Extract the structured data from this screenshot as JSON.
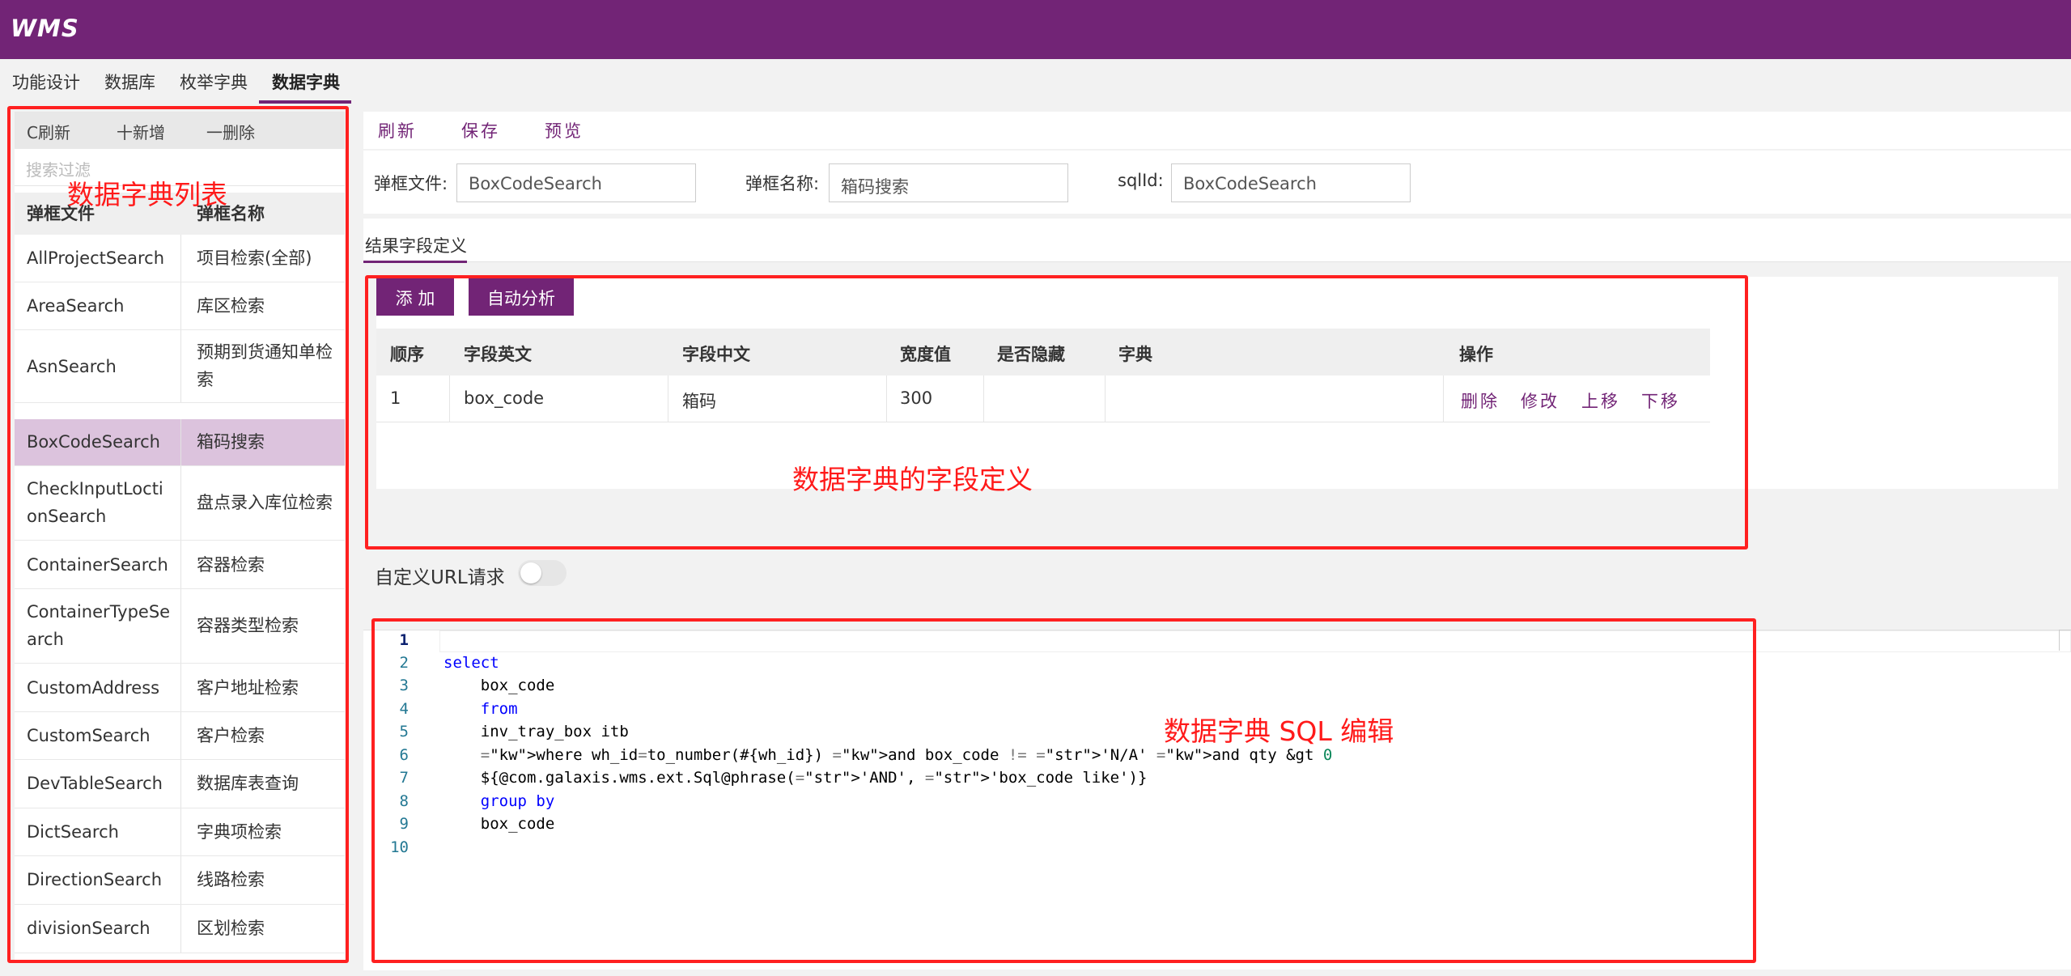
{
  "app": {
    "logo": "WMS",
    "brand_color": "#722476"
  },
  "tabs": [
    {
      "label": "功能设计",
      "active": false
    },
    {
      "label": "数据库",
      "active": false
    },
    {
      "label": "枚举字典",
      "active": false
    },
    {
      "label": "数据字典",
      "active": true
    }
  ],
  "left": {
    "toolbar": {
      "refresh": "C刷新",
      "add": "十新增",
      "delete": "一删除"
    },
    "search_placeholder": "搜索过滤",
    "columns": [
      "弹框文件",
      "弹框名称"
    ],
    "rows": [
      {
        "file": "AllProjectSearch",
        "name": "项目检索(全部)"
      },
      {
        "file": "AreaSearch",
        "name": "库区检索"
      },
      {
        "file": "AsnSearch",
        "name": "预期到货通知单检索"
      },
      {
        "file": "BoxCodeSearch",
        "name": "箱码搜索",
        "selected": true
      },
      {
        "file": "CheckInputLoctionSearch",
        "name": "盘点录入库位检索"
      },
      {
        "file": "ContainerSearch",
        "name": "容器检索"
      },
      {
        "file": "ContainerTypeSearch",
        "name": "容器类型检索"
      },
      {
        "file": "CustomAddress",
        "name": "客户地址检索"
      },
      {
        "file": "CustomSearch",
        "name": "客户检索"
      },
      {
        "file": "DevTableSearch",
        "name": "数据库表查询"
      },
      {
        "file": "DictSearch",
        "name": "字典项检索"
      },
      {
        "file": "DirectionSearch",
        "name": "线路检索"
      },
      {
        "file": "divisionSearch",
        "name": "区划检索"
      }
    ]
  },
  "right": {
    "toolbar": {
      "refresh": "刷新",
      "save": "保存",
      "preview": "预览"
    },
    "form": {
      "file_label": "弹框文件:",
      "file_value": "BoxCodeSearch",
      "name_label": "弹框名称:",
      "name_value": "箱码搜索",
      "sql_label": "sqlId:",
      "sql_value": "BoxCodeSearch"
    },
    "section_tab": "结果字段定义",
    "buttons": {
      "add": "添 加",
      "auto": "自动分析"
    },
    "field_columns": [
      "顺序",
      "字段英文",
      "字段中文",
      "宽度值",
      "是否隐藏",
      "字典",
      "操作"
    ],
    "field_rows": [
      {
        "order": "1",
        "en": "box_code",
        "cn": "箱码",
        "width": "300",
        "hidden": "",
        "dict": ""
      }
    ],
    "row_ops": [
      "删除",
      "修改",
      "上移",
      "下移"
    ],
    "url_label": "自定义URL请求",
    "url_toggle_on": false,
    "sql_lines": [
      "",
      "select",
      "    box_code",
      "    from",
      "    inv_tray_box itb",
      "    where wh_id=to_number(#{wh_id}) and box_code != 'N/A' and qty &gt 0",
      "    ${@com.galaxis.wms.ext.Sql@phrase('AND', 'box_code like')}",
      "    group by",
      "    box_code",
      ""
    ]
  },
  "annotations": {
    "list": "数据字典列表",
    "fields": "数据字典的字段定义",
    "sql": "数据字典 SQL 编辑",
    "color": "#ff2020"
  }
}
